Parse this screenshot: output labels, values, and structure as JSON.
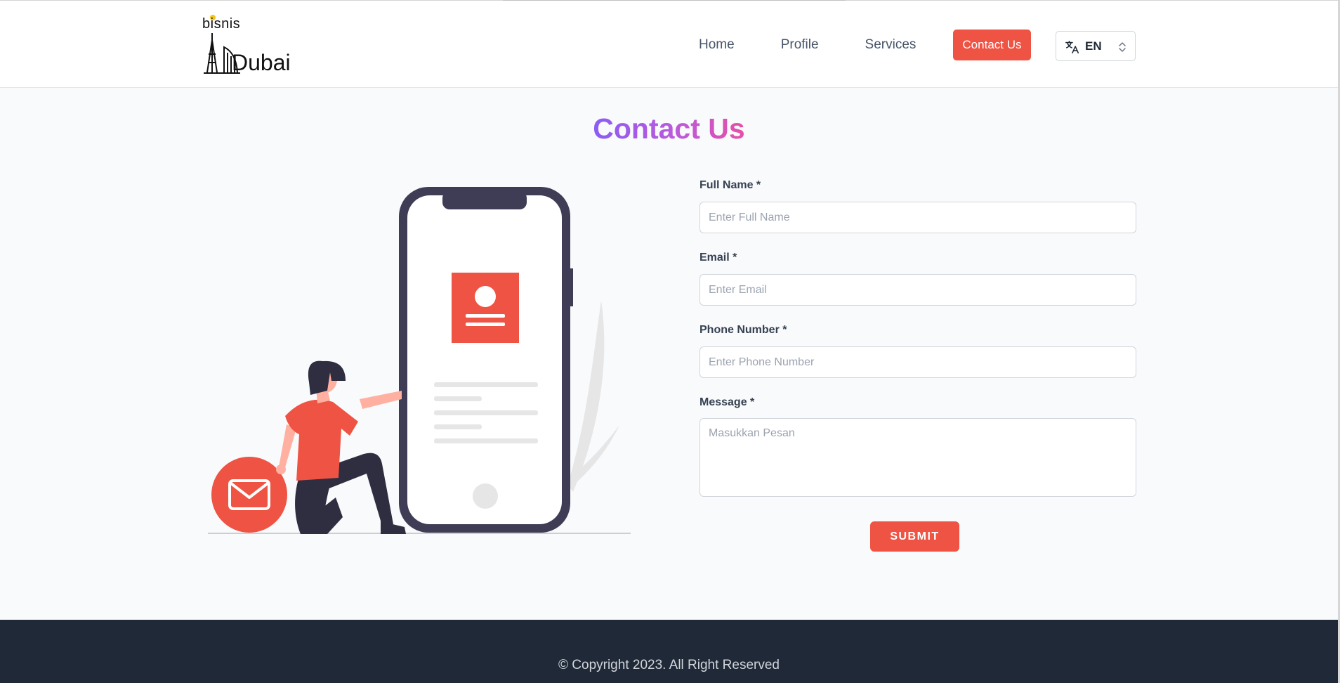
{
  "header": {
    "logo": {
      "top_word": "bisnis",
      "bottom_word": "Dubai"
    },
    "nav": [
      {
        "label": "Home"
      },
      {
        "label": "Profile"
      },
      {
        "label": "Services"
      }
    ],
    "cta_label": "Contact Us",
    "language": {
      "value": "EN",
      "icon": "translate-icon"
    }
  },
  "page": {
    "title": "Contact Us"
  },
  "form": {
    "full_name": {
      "label": "Full Name *",
      "placeholder": "Enter Full Name",
      "value": ""
    },
    "email": {
      "label": "Email *",
      "placeholder": "Enter Email",
      "value": ""
    },
    "phone": {
      "label": "Phone Number *",
      "placeholder": "Enter Phone Number",
      "value": ""
    },
    "message": {
      "label": "Message *",
      "placeholder": "Masukkan Pesan",
      "value": ""
    },
    "submit_label": "SUBMIT"
  },
  "footer": {
    "copyright": "© Copyright 2023. All Right Reserved"
  },
  "colors": {
    "accent": "#ef5343",
    "title_gradient_start": "#8b5cf6",
    "title_gradient_end": "#e64fa6",
    "footer_bg": "#1f2937",
    "phone_frame": "#3f3d56"
  }
}
